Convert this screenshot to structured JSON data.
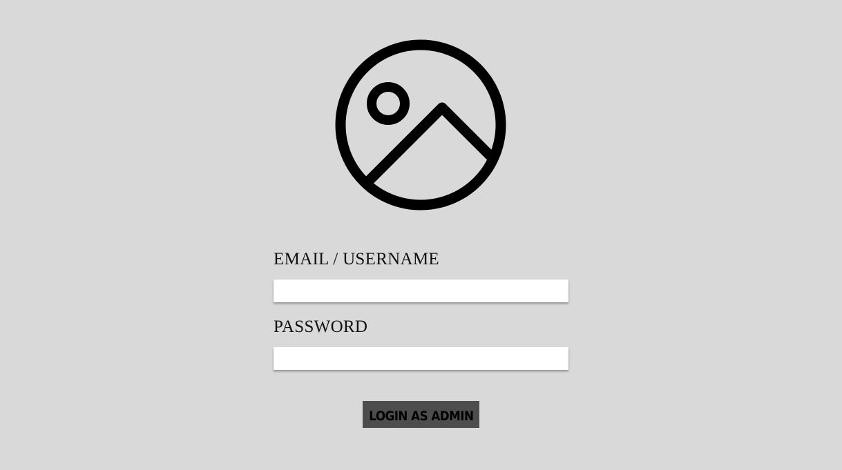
{
  "logo": {
    "icon": "image-placeholder-icon",
    "stroke_color": "#000000"
  },
  "form": {
    "email_label": "EMAIL / USERNAME",
    "email_value": "",
    "email_placeholder": "",
    "password_label": "PASSWORD",
    "password_value": "",
    "password_placeholder": "",
    "submit_label": "LOGIN AS ADMIN"
  },
  "colors": {
    "background": "#d9d9d9",
    "button_background": "#4d4d4d",
    "field_background": "#ffffff"
  }
}
